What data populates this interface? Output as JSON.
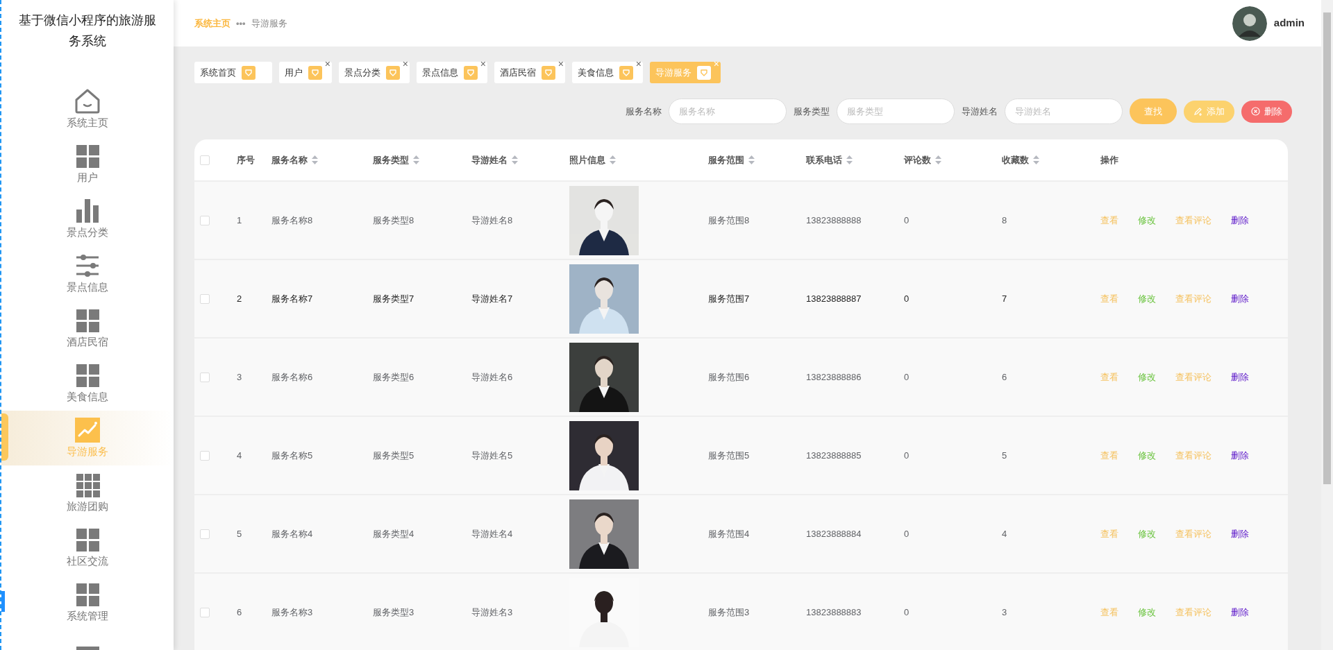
{
  "sidebar": {
    "title": "基于微信小程序的旅游服务系统",
    "items": [
      {
        "kind": "home",
        "label": "系统主页",
        "selected": false
      },
      {
        "kind": "grid",
        "label": "用户",
        "selected": false
      },
      {
        "kind": "bars",
        "label": "景点分类",
        "selected": false
      },
      {
        "kind": "sliders",
        "label": "景点信息",
        "selected": false
      },
      {
        "kind": "grid",
        "label": "酒店民宿",
        "selected": false
      },
      {
        "kind": "grid",
        "label": "美食信息",
        "selected": false
      },
      {
        "kind": "trend",
        "label": "导游服务",
        "selected": true
      },
      {
        "kind": "grid9",
        "label": "旅游团购",
        "selected": false
      },
      {
        "kind": "grid",
        "label": "社区交流",
        "selected": false
      },
      {
        "kind": "grid",
        "label": "系统管理",
        "selected": false
      },
      {
        "kind": "block",
        "selected": false
      }
    ]
  },
  "breadcrumb": [
    {
      "label": "系统主页",
      "kind": "link"
    },
    {
      "label": "•••",
      "kind": "separator"
    },
    {
      "label": "导游服务",
      "kind": "current"
    }
  ],
  "user": {
    "name": "admin"
  },
  "tabs": [
    {
      "label": "系统首页",
      "selected": false,
      "closable": false
    },
    {
      "label": "用户",
      "selected": false,
      "closable": true
    },
    {
      "label": "景点分类",
      "selected": false,
      "closable": true
    },
    {
      "label": "景点信息",
      "selected": false,
      "closable": true
    },
    {
      "label": "酒店民宿",
      "selected": false,
      "closable": true
    },
    {
      "label": "美食信息",
      "selected": false,
      "closable": true
    },
    {
      "label": "导游服务",
      "selected": true,
      "closable": true
    }
  ],
  "close_glyph": "×",
  "search": {
    "fields": [
      {
        "label": "服务名称",
        "placeholder": "服务名称"
      },
      {
        "label": "服务类型",
        "placeholder": "服务类型"
      },
      {
        "label": "导游姓名",
        "placeholder": "导游姓名"
      }
    ],
    "buttons": [
      {
        "label": "查找",
        "kind": "search"
      },
      {
        "label": "添加",
        "kind": "add"
      },
      {
        "label": "删除",
        "kind": "delete"
      }
    ]
  },
  "table": {
    "columns": [
      {
        "label": "序号",
        "sortable": false
      },
      {
        "label": "服务名称",
        "sortable": true
      },
      {
        "label": "服务类型",
        "sortable": true
      },
      {
        "label": "导游姓名",
        "sortable": true
      },
      {
        "label": "照片信息",
        "sortable": true
      },
      {
        "label": "服务范围",
        "sortable": true
      },
      {
        "label": "联系电话",
        "sortable": true
      },
      {
        "label": "评论数",
        "sortable": true
      },
      {
        "label": "收藏数",
        "sortable": true
      },
      {
        "label": "操作",
        "sortable": false
      }
    ],
    "all_checked": false,
    "rows": [
      {
        "index": "1",
        "name": "服务名称8",
        "type": "服务类型8",
        "guide": "导游姓名8",
        "scope": "服务范围8",
        "phone": "13823888888",
        "comments": "0",
        "favorites": "8",
        "hovered": false,
        "checked": false,
        "actions": [
          {
            "label": "查看",
            "kind": "view"
          },
          {
            "label": "修改",
            "kind": "edit"
          },
          {
            "label": "查看评论",
            "kind": "comments"
          },
          {
            "label": "删除",
            "kind": "delete"
          }
        ]
      },
      {
        "index": "2",
        "name": "服务名称7",
        "type": "服务类型7",
        "guide": "导游姓名7",
        "scope": "服务范围7",
        "phone": "13823888887",
        "comments": "0",
        "favorites": "7",
        "hovered": true,
        "checked": false,
        "actions": [
          {
            "label": "查看",
            "kind": "view"
          },
          {
            "label": "修改",
            "kind": "edit"
          },
          {
            "label": "查看评论",
            "kind": "comments"
          },
          {
            "label": "删除",
            "kind": "delete"
          }
        ]
      },
      {
        "index": "3",
        "name": "服务名称6",
        "type": "服务类型6",
        "guide": "导游姓名6",
        "scope": "服务范围6",
        "phone": "13823888886",
        "comments": "0",
        "favorites": "6",
        "hovered": false,
        "checked": false,
        "actions": [
          {
            "label": "查看",
            "kind": "view"
          },
          {
            "label": "修改",
            "kind": "edit"
          },
          {
            "label": "查看评论",
            "kind": "comments"
          },
          {
            "label": "删除",
            "kind": "delete"
          }
        ]
      },
      {
        "index": "4",
        "name": "服务名称5",
        "type": "服务类型5",
        "guide": "导游姓名5",
        "scope": "服务范围5",
        "phone": "13823888885",
        "comments": "0",
        "favorites": "5",
        "hovered": false,
        "checked": false,
        "actions": [
          {
            "label": "查看",
            "kind": "view"
          },
          {
            "label": "修改",
            "kind": "edit"
          },
          {
            "label": "查看评论",
            "kind": "comments"
          },
          {
            "label": "删除",
            "kind": "delete"
          }
        ]
      },
      {
        "index": "5",
        "name": "服务名称4",
        "type": "服务类型4",
        "guide": "导游姓名4",
        "scope": "服务范围4",
        "phone": "13823888884",
        "comments": "0",
        "favorites": "4",
        "hovered": false,
        "checked": false,
        "actions": [
          {
            "label": "查看",
            "kind": "view"
          },
          {
            "label": "修改",
            "kind": "edit"
          },
          {
            "label": "查看评论",
            "kind": "comments"
          },
          {
            "label": "删除",
            "kind": "delete"
          }
        ]
      },
      {
        "index": "6",
        "name": "服务名称3",
        "type": "服务类型3",
        "guide": "导游姓名3",
        "scope": "服务范围3",
        "phone": "13823888883",
        "comments": "0",
        "favorites": "3",
        "hovered": false,
        "checked": false,
        "actions": [
          {
            "label": "查看",
            "kind": "view"
          },
          {
            "label": "修改",
            "kind": "edit"
          },
          {
            "label": "查看评论",
            "kind": "comments"
          },
          {
            "label": "删除",
            "kind": "delete"
          }
        ]
      }
    ]
  }
}
